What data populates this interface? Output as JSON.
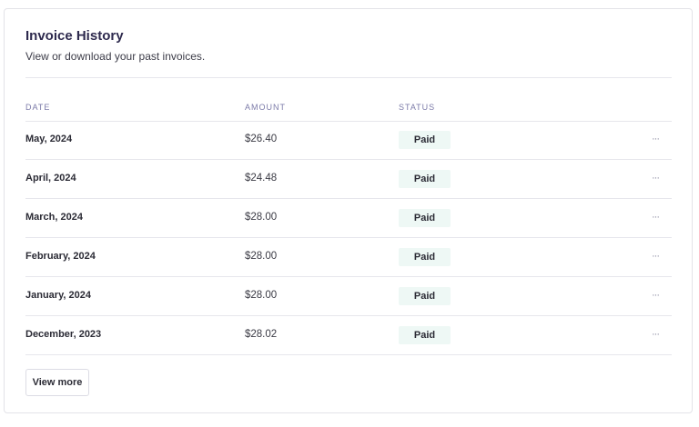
{
  "header": {
    "title": "Invoice History",
    "subtitle": "View or download your past invoices."
  },
  "table": {
    "columns": [
      "DATE",
      "AMOUNT",
      "STATUS"
    ],
    "rows": [
      {
        "date": "May, 2024",
        "amount": "$26.40",
        "status": "Paid"
      },
      {
        "date": "April, 2024",
        "amount": "$24.48",
        "status": "Paid"
      },
      {
        "date": "March, 2024",
        "amount": "$28.00",
        "status": "Paid"
      },
      {
        "date": "February, 2024",
        "amount": "$28.00",
        "status": "Paid"
      },
      {
        "date": "January, 2024",
        "amount": "$28.00",
        "status": "Paid"
      },
      {
        "date": "December, 2023",
        "amount": "$28.02",
        "status": "Paid"
      }
    ],
    "row_menu_icon": "ellipsis-icon",
    "row_menu_glyph": "···"
  },
  "footer": {
    "view_more_label": "View more"
  },
  "colors": {
    "title": "#2e2a4e",
    "header_text": "#7b7aa8",
    "badge_bg": "#eef8f5",
    "border": "#e6e6ec"
  }
}
